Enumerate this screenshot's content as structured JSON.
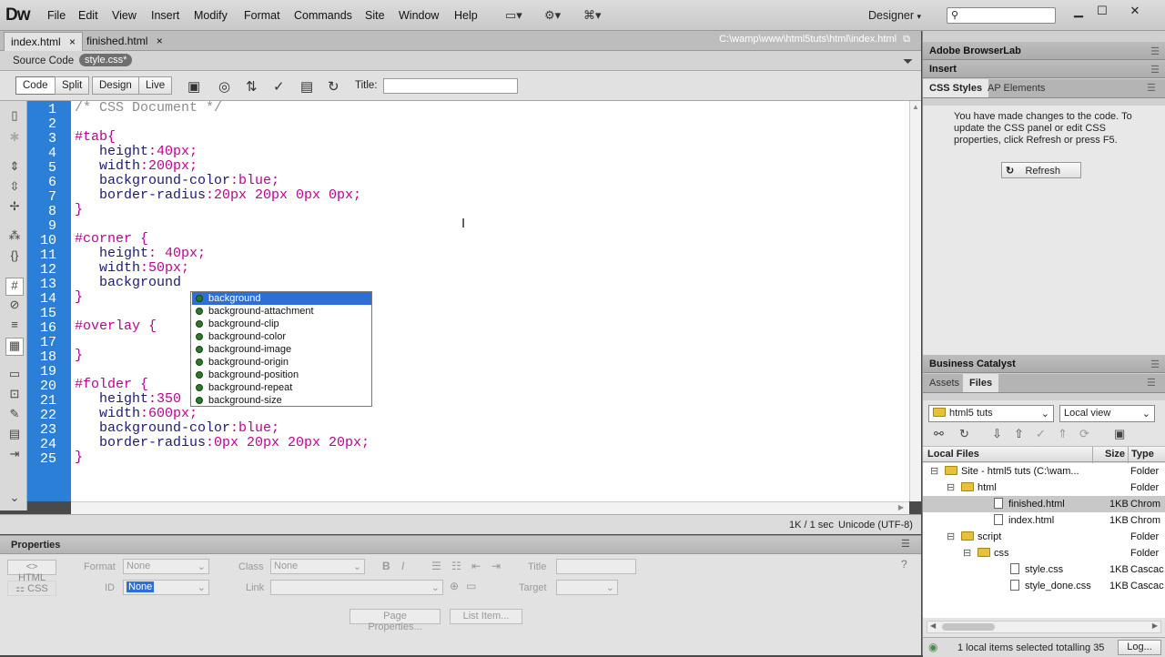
{
  "app": {
    "logo": "Dw"
  },
  "menu": [
    "File",
    "Edit",
    "View",
    "Insert",
    "Modify",
    "Format",
    "Commands",
    "Site",
    "Window",
    "Help"
  ],
  "workspace": "Designer",
  "tabs": [
    {
      "label": "index.html",
      "close": "×"
    },
    {
      "label": "finished.html",
      "close": "×"
    }
  ],
  "path": "C:\\wamp\\www\\html5tuts\\html\\index.html",
  "source_bar": {
    "source_label": "Source Code",
    "related": "style.css*"
  },
  "view_buttons": [
    "Code",
    "Split",
    "Design",
    "Live"
  ],
  "toolbar": {
    "title_label": "Title:",
    "title_value": ""
  },
  "code_lines": [
    [
      {
        "t": "/* CSS Document */",
        "c": "cm"
      }
    ],
    [],
    [
      {
        "t": "#tab{",
        "c": "pk"
      }
    ],
    [
      {
        "t": "   height",
        "c": "tx"
      },
      {
        "t": ":40px;",
        "c": "pk"
      }
    ],
    [
      {
        "t": "   width",
        "c": "tx"
      },
      {
        "t": ":200px;",
        "c": "pk"
      }
    ],
    [
      {
        "t": "   background-color",
        "c": "tx"
      },
      {
        "t": ":blue;",
        "c": "pk"
      }
    ],
    [
      {
        "t": "   border-radius",
        "c": "tx"
      },
      {
        "t": ":20px 20px 0px 0px;",
        "c": "pk"
      }
    ],
    [
      {
        "t": "}",
        "c": "pk"
      }
    ],
    [],
    [
      {
        "t": "#corner {",
        "c": "pk"
      }
    ],
    [
      {
        "t": "   height",
        "c": "tx"
      },
      {
        "t": ": 40px;",
        "c": "pk"
      }
    ],
    [
      {
        "t": "   width",
        "c": "tx"
      },
      {
        "t": ":50px;",
        "c": "pk"
      }
    ],
    [
      {
        "t": "   background",
        "c": "tx"
      }
    ],
    [
      {
        "t": "}",
        "c": "pk"
      }
    ],
    [],
    [
      {
        "t": "#overlay {",
        "c": "pk"
      }
    ],
    [],
    [
      {
        "t": "}",
        "c": "pk"
      }
    ],
    [],
    [
      {
        "t": "#folder {",
        "c": "pk"
      }
    ],
    [
      {
        "t": "   height",
        "c": "tx"
      },
      {
        "t": ":350",
        "c": "pk"
      }
    ],
    [
      {
        "t": "   width",
        "c": "tx"
      },
      {
        "t": ":600px;",
        "c": "pk"
      }
    ],
    [
      {
        "t": "   background-color",
        "c": "tx"
      },
      {
        "t": ":blue;",
        "c": "pk"
      }
    ],
    [
      {
        "t": "   border-radius",
        "c": "tx"
      },
      {
        "t": ":0px 20px 20px 20px;",
        "c": "pk"
      }
    ],
    [
      {
        "t": "}",
        "c": "pk"
      }
    ]
  ],
  "autocomplete": [
    "background",
    "background-attachment",
    "background-clip",
    "background-color",
    "background-image",
    "background-origin",
    "background-position",
    "background-repeat",
    "background-size"
  ],
  "status": {
    "size_time": "1K / 1 sec",
    "encoding": "Unicode (UTF-8)"
  },
  "properties": {
    "title": "Properties",
    "html_btn": "HTML",
    "css_btn": "CSS",
    "format_label": "Format",
    "format_value": "None",
    "class_label": "Class",
    "class_value": "None",
    "id_label": "ID",
    "id_value": "None",
    "link_label": "Link",
    "title_label": "Title",
    "target_label": "Target",
    "page_props": "Page Properties...",
    "list_item": "List Item..."
  },
  "panels": {
    "browserlab": "Adobe BrowserLab",
    "insert": "Insert",
    "css_tabs": [
      "CSS Styles",
      "AP Elements"
    ],
    "css_message": "You have made changes to the code. To update the CSS panel or edit CSS properties, click Refresh or press F5.",
    "refresh": "Refresh",
    "business": "Business Catalyst",
    "files_tabs": [
      "Assets",
      "Files"
    ],
    "site_select": "html5 tuts",
    "view_select": "Local view",
    "cols": {
      "name": "Local Files",
      "size": "Size",
      "type": "Type"
    },
    "files": [
      {
        "name": "Site - html5 tuts (C:\\wam...",
        "size": "",
        "type": "Folder",
        "kind": "folder",
        "indent": 0,
        "toggle": "⊟"
      },
      {
        "name": "html",
        "size": "",
        "type": "Folder",
        "kind": "folder",
        "indent": 1,
        "toggle": "⊟"
      },
      {
        "name": "finished.html",
        "size": "1KB",
        "type": "Chrom",
        "kind": "file",
        "indent": 3,
        "toggle": ""
      },
      {
        "name": "index.html",
        "size": "1KB",
        "type": "Chrom",
        "kind": "file",
        "indent": 3,
        "toggle": ""
      },
      {
        "name": "script",
        "size": "",
        "type": "Folder",
        "kind": "folder",
        "indent": 1,
        "toggle": "⊟"
      },
      {
        "name": "css",
        "size": "",
        "type": "Folder",
        "kind": "folder",
        "indent": 2,
        "toggle": "⊟"
      },
      {
        "name": "style.css",
        "size": "1KB",
        "type": "Cascac",
        "kind": "file",
        "indent": 4,
        "toggle": ""
      },
      {
        "name": "style_done.css",
        "size": "1KB",
        "type": "Cascac",
        "kind": "file",
        "indent": 4,
        "toggle": ""
      }
    ],
    "files_status": "1 local items selected totalling 35",
    "log": "Log..."
  }
}
